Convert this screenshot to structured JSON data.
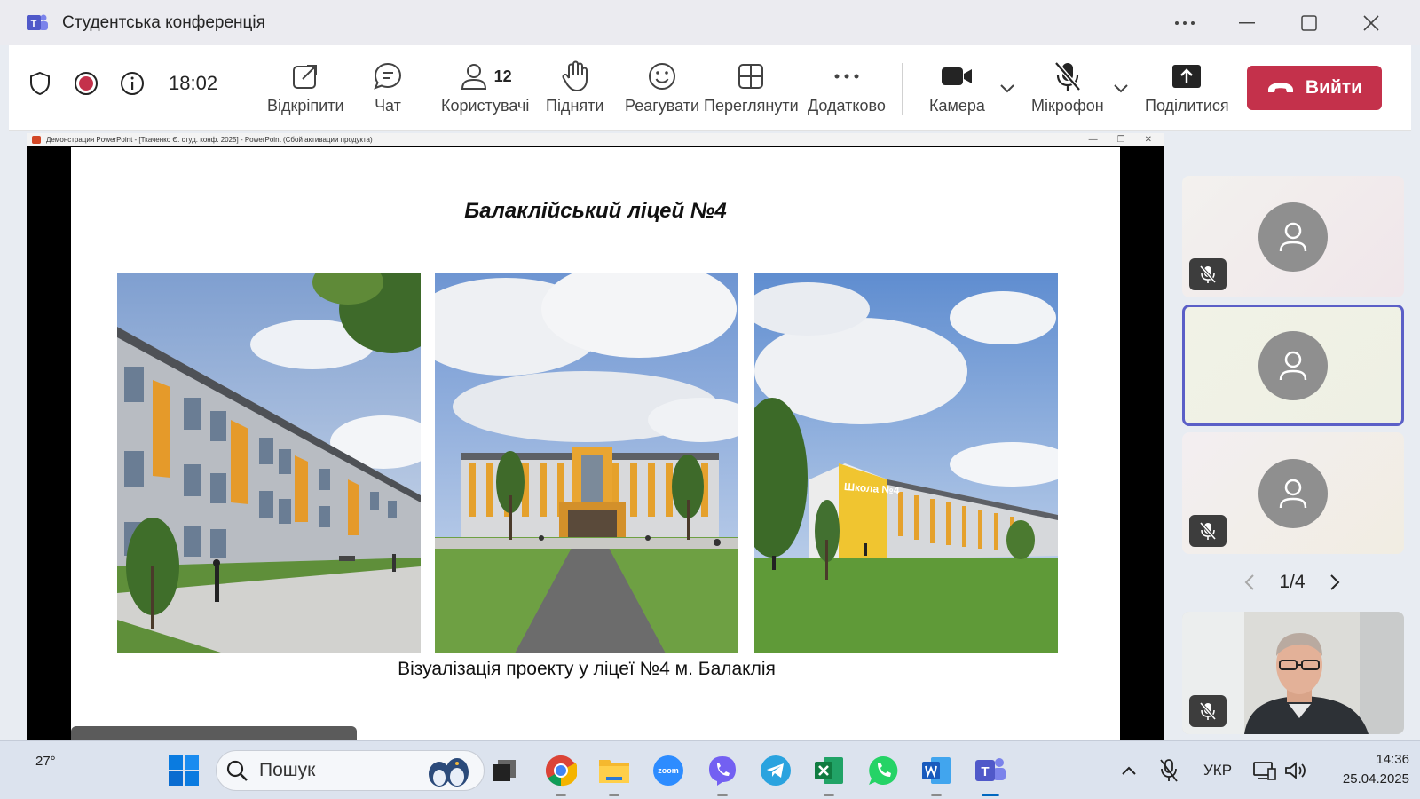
{
  "window": {
    "title": "Студентська конференція",
    "more_label": "···"
  },
  "toolbar": {
    "timer": "18:02",
    "buttons": {
      "popout": "Відкріпити",
      "chat": "Чат",
      "people": "Користувачі",
      "people_count": "12",
      "raise": "Підняти",
      "react": "Реагувати",
      "view": "Переглянути",
      "more": "Додатково",
      "camera": "Камера",
      "mic": "Мікрофон",
      "share": "Поділитися"
    },
    "leave_label": "Вийти",
    "leave_color": "#c4314b"
  },
  "shared_screen": {
    "window_title": "Демонстрация PowerPoint - [Ткаченко Є. студ. конф. 2025] - PowerPoint (Сбой активации продукта)",
    "slide": {
      "title": "Балаклійський ліцей №4",
      "caption": "Візуалізація проекту у ліцеї №4 м. Балаклія",
      "sign_text": "Школа №4"
    }
  },
  "participants": {
    "pager": "1/4",
    "active_border_color": "#5b5fc7"
  },
  "taskbar": {
    "weather": "27°",
    "search_placeholder": "Пошук",
    "apps": [
      "chrome",
      "explorer",
      "zoom",
      "viber",
      "telegram",
      "excel",
      "whatsapp",
      "word",
      "teams"
    ],
    "zoom_label": "zoom",
    "language": "УКР",
    "time": "14:36",
    "date": "25.04.2025"
  }
}
